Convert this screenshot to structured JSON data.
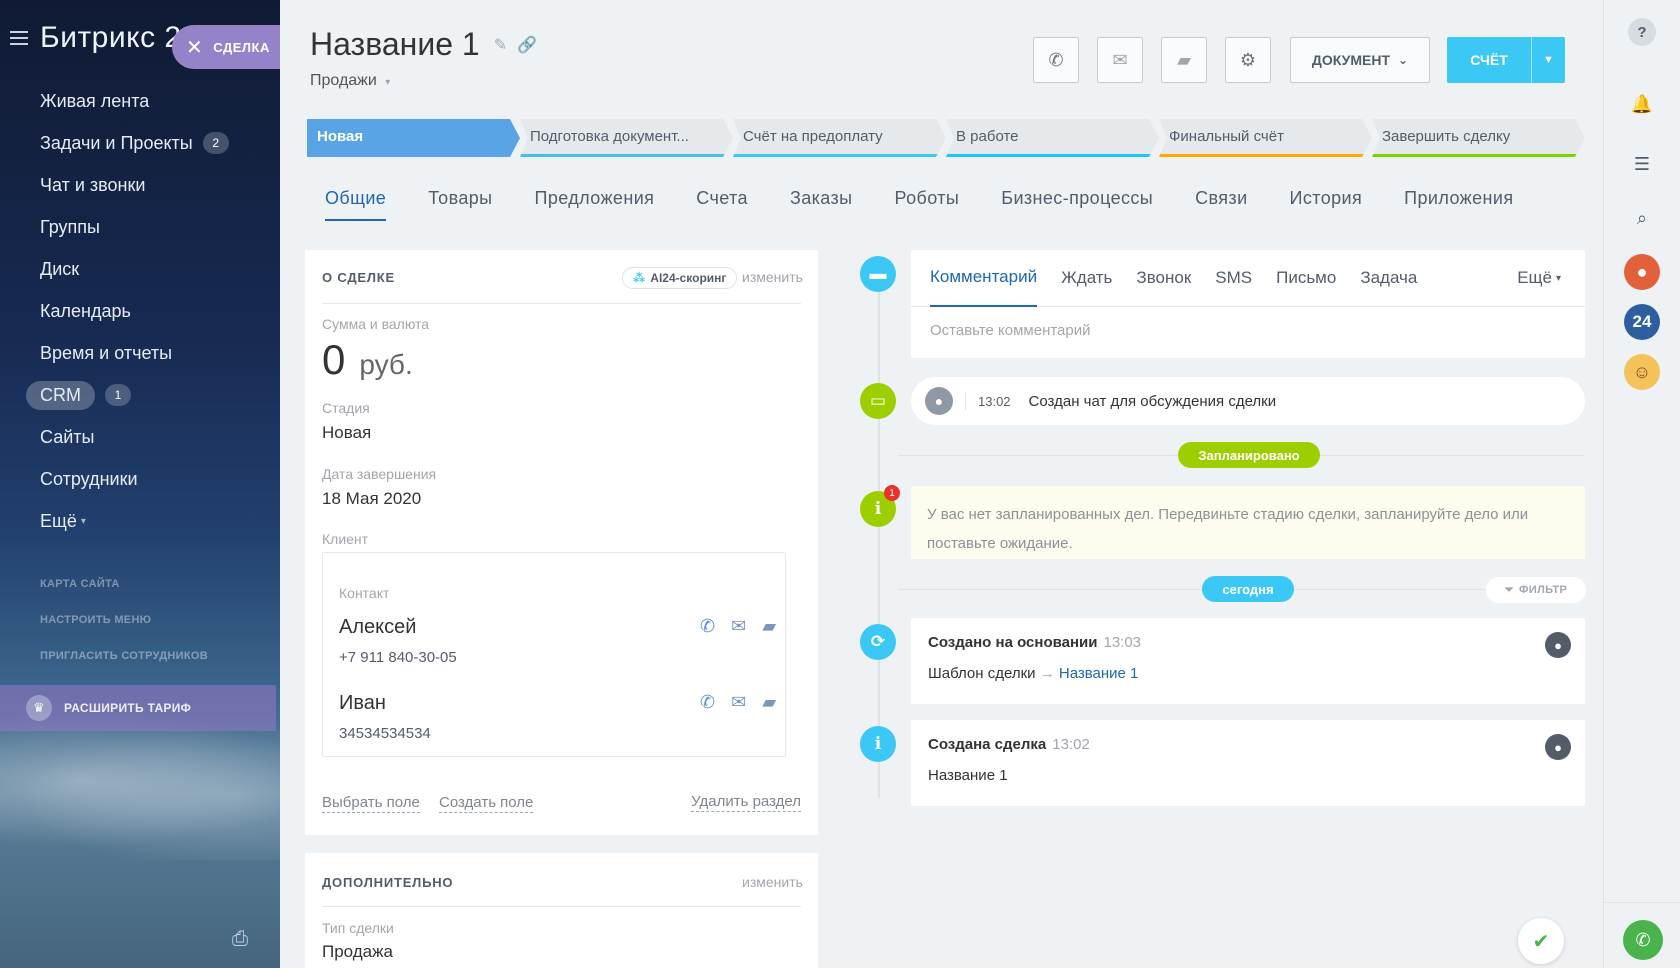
{
  "sidebar": {
    "brand": "Битрикс 24",
    "deal_pill": "СДЕЛКА",
    "items": [
      {
        "label": "Живая лента"
      },
      {
        "label": "Задачи и Проекты",
        "badge": "2"
      },
      {
        "label": "Чат и звонки"
      },
      {
        "label": "Группы"
      },
      {
        "label": "Диск"
      },
      {
        "label": "Календарь"
      },
      {
        "label": "Время и отчеты"
      },
      {
        "label": "CRM",
        "badge": "1"
      },
      {
        "label": "Сайты"
      },
      {
        "label": "Сотрудники"
      },
      {
        "label": "Ещё"
      }
    ],
    "small_links": [
      "КАРТА САЙТА",
      "НАСТРОИТЬ МЕНЮ",
      "ПРИГЛАСИТЬ СОТРУДНИКОВ"
    ],
    "upgrade": "РАСШИРИТЬ ТАРИФ"
  },
  "header": {
    "title": "Название 1",
    "pipeline": "Продажи",
    "document_btn": "ДОКУМЕНТ",
    "invoice_btn": "СЧЁТ"
  },
  "stages": [
    {
      "label": "Новая",
      "color": "#5aa4e6",
      "active": true
    },
    {
      "label": "Подготовка документ...",
      "color": "#47bfe6"
    },
    {
      "label": "Счёт на предоплату",
      "color": "#3bc8f5"
    },
    {
      "label": "В работе",
      "color": "#1ec6fa"
    },
    {
      "label": "Финальный счёт",
      "color": "#ffa900"
    },
    {
      "label": "Завершить сделку",
      "color": "#7bd500"
    }
  ],
  "tabs": [
    "Общие",
    "Товары",
    "Предложения",
    "Счета",
    "Заказы",
    "Роботы",
    "Бизнес-процессы",
    "Связи",
    "История",
    "Приложения"
  ],
  "about": {
    "header": "О СДЕЛКЕ",
    "ai_scoring": "AI24-скоринг",
    "edit": "изменить",
    "amount_label": "Сумма и валюта",
    "amount": "0",
    "currency": "руб.",
    "stage_label": "Стадия",
    "stage": "Новая",
    "close_label": "Дата завершения",
    "close_date": "18 Мая 2020",
    "client_label": "Клиент",
    "contact_label": "Контакт",
    "contacts": [
      {
        "name": "Алексей",
        "phone": "+7 911 840-30-05"
      },
      {
        "name": "Иван",
        "phone": "34534534534"
      }
    ],
    "select_field": "Выбрать поле",
    "create_field": "Создать поле",
    "delete_section": "Удалить раздел"
  },
  "extra": {
    "header": "ДОПОЛНИТЕЛЬНО",
    "edit": "изменить",
    "type_label": "Тип сделки",
    "type": "Продажа"
  },
  "editor": {
    "tabs": [
      "Комментарий",
      "Ждать",
      "Звонок",
      "SMS",
      "Письмо",
      "Задача"
    ],
    "more": "Ещё",
    "placeholder": "Оставьте комментарий"
  },
  "timeline": {
    "chat_time": "13:02",
    "chat_text": "Создан чат для обсуждения сделки",
    "planned_pill": "Запланировано",
    "warning_count": "1",
    "warning": "У вас нет запланированных дел. Передвиньте стадию сделки, запланируйте дело или поставьте ожидание.",
    "today_pill": "сегодня",
    "filter": "ФИЛЬТР",
    "events": [
      {
        "title": "Создано на основании",
        "time": "13:03",
        "body_prefix": "Шаблон сделки",
        "arrow": "→",
        "link": "Название 1"
      },
      {
        "title": "Создана сделка",
        "time": "13:02",
        "body": "Название 1"
      }
    ]
  },
  "colors": {
    "accent": "#2067b0",
    "green": "#9dcf00",
    "blue": "#3bc8f5"
  }
}
